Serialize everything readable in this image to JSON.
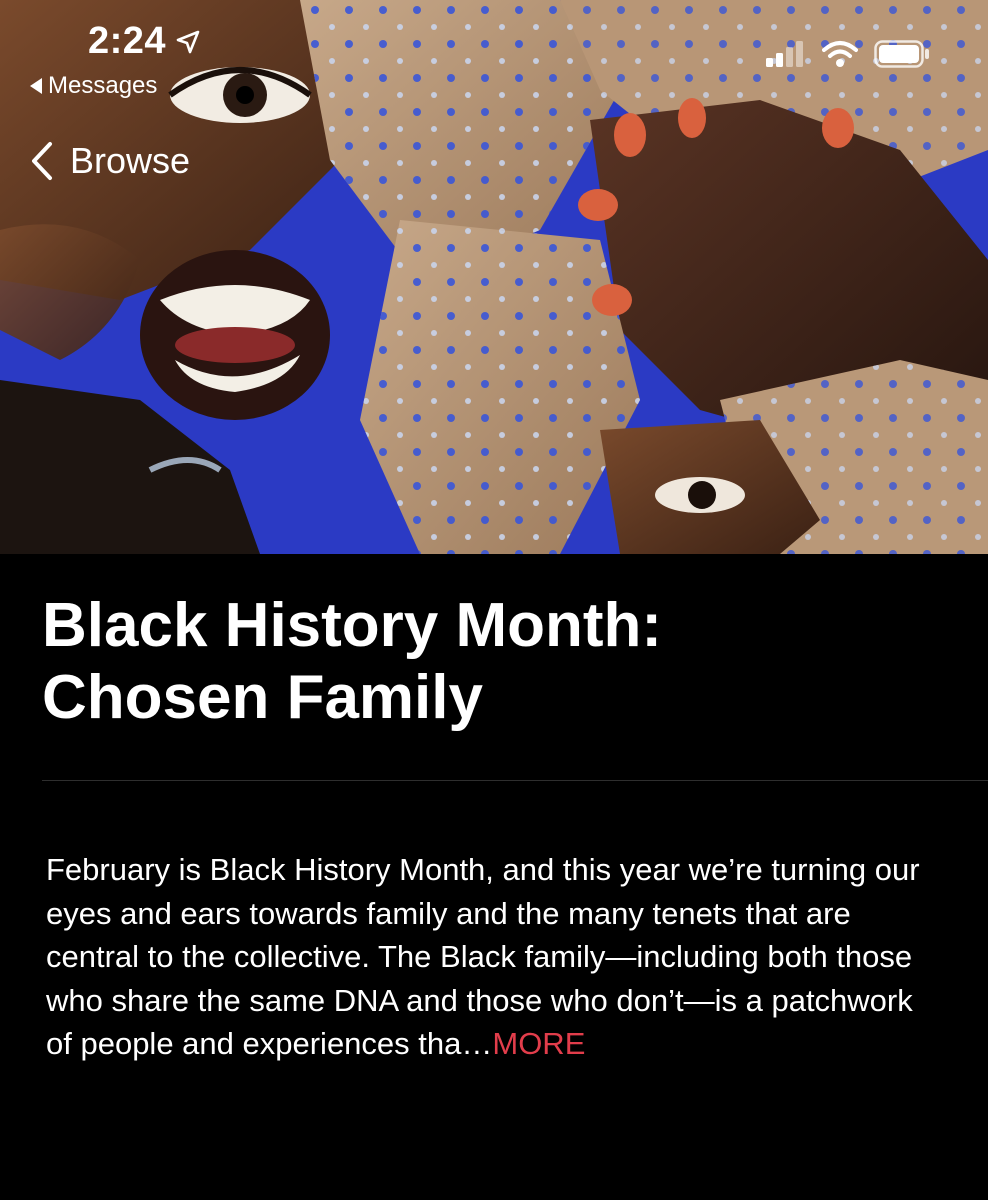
{
  "status_bar": {
    "time": "2:24",
    "back_app_label": "Messages"
  },
  "nav": {
    "back_label": "Browse"
  },
  "article": {
    "title_line1": "Black History Month:",
    "title_line2": "Chosen Family",
    "description": "February is Black History Month, and this year we’re turning our eyes and ears towards family and the many tenets that are central to the collective. The Black family—including both those who share the same DNA and those who don’t—is a patchwork of people and experiences tha…",
    "more_label": "MORE"
  },
  "colors": {
    "background": "#000000",
    "more_accent": "#e23d4b",
    "hero_blue": "#2b3ac4"
  },
  "icons": [
    "location-arrow-icon",
    "back-triangle-icon",
    "cellular-signal-icon",
    "wifi-icon",
    "battery-icon",
    "chevron-left-icon"
  ]
}
